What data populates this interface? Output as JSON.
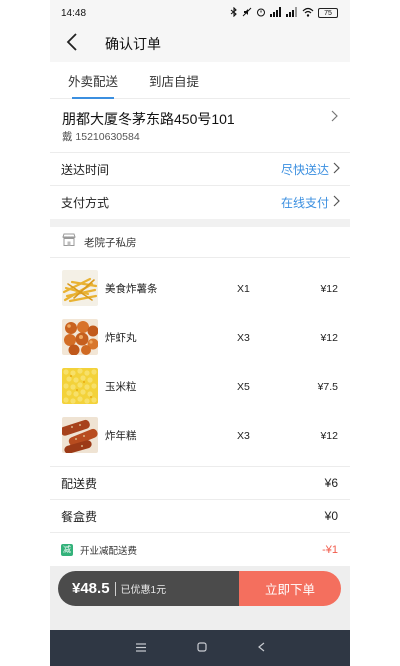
{
  "status_bar": {
    "time": "14:48",
    "network_labels": [
      "4G",
      "4G"
    ],
    "battery": "75"
  },
  "nav": {
    "title": "确认订单"
  },
  "tabs": [
    {
      "label": "外卖配送",
      "active": true
    },
    {
      "label": "到店自提",
      "active": false
    }
  ],
  "address": {
    "line": "朋都大厦冬茅东路450号101",
    "contact": "戴 15210630584"
  },
  "delivery": {
    "label": "送达时间",
    "value": "尽快送达"
  },
  "payment": {
    "label": "支付方式",
    "value": "在线支付"
  },
  "shop": {
    "icon": "shop-icon",
    "name": "老院子私房"
  },
  "items": [
    {
      "name": "美食炸薯条",
      "qty": "X1",
      "price": "¥12",
      "thumb": "fries"
    },
    {
      "name": "炸虾丸",
      "qty": "X3",
      "price": "¥12",
      "thumb": "meatballs"
    },
    {
      "name": "玉米粒",
      "qty": "X5",
      "price": "¥7.5",
      "thumb": "corn"
    },
    {
      "name": "炸年糕",
      "qty": "X3",
      "price": "¥12",
      "thumb": "ricecake"
    }
  ],
  "fees": {
    "delivery_label": "配送费",
    "delivery_value": "¥6",
    "box_label": "餐盒费",
    "box_value": "¥0",
    "discount_badge": "减",
    "discount_label": "开业减配送费",
    "discount_value": "-¥1"
  },
  "checkout": {
    "total": "¥48.5",
    "saved": "已优惠1元",
    "submit": "立即下单"
  },
  "colors": {
    "accent": "#3b8fe0",
    "submit": "#f46f5e",
    "discount": "#f15a4a",
    "badge": "#33b27a"
  }
}
